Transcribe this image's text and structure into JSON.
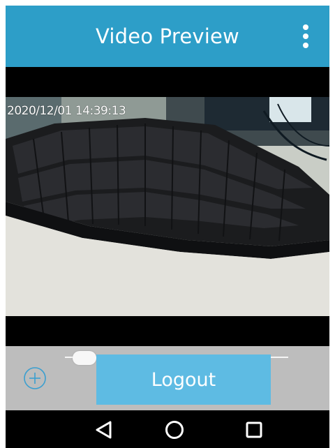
{
  "app_bar": {
    "title": "Video Preview",
    "menu_icon": "overflow-menu-icon",
    "color": "#2d9ec8"
  },
  "video": {
    "timestamp": "2020/12/01 14:39:13"
  },
  "controls": {
    "zoom_icon": "zoom-in-icon",
    "logout_label": "Logout",
    "logout_color": "#5ebbe3",
    "panel_color": "#bdbdbd"
  },
  "nav_bar": {
    "back_icon": "back-triangle-icon",
    "home_icon": "home-circle-icon",
    "recents_icon": "recents-square-icon"
  }
}
